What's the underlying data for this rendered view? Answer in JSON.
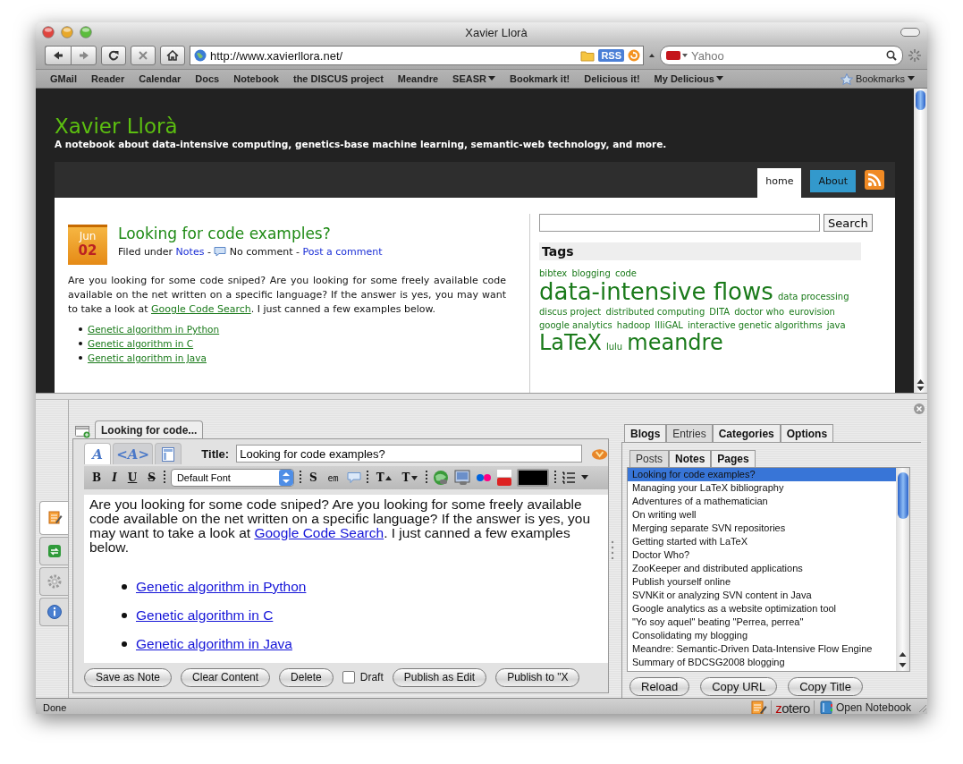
{
  "window": {
    "title": "Xavier Llorà"
  },
  "toolbar": {
    "url": "http://www.xavierllora.net/",
    "feed_badge": "RSS",
    "search": {
      "placeholder": "Yahoo"
    }
  },
  "bookmarks": [
    {
      "label": "GMail",
      "kind": "link"
    },
    {
      "label": "Reader",
      "kind": "link"
    },
    {
      "label": "Calendar",
      "kind": "link"
    },
    {
      "label": "Docs",
      "kind": "link"
    },
    {
      "label": "Notebook",
      "kind": "link"
    },
    {
      "label": "the DISCUS project",
      "kind": "link"
    },
    {
      "label": "Meandre",
      "kind": "link"
    },
    {
      "label": "SEASR",
      "kind": "menu"
    },
    {
      "label": "Bookmark it!",
      "kind": "link"
    },
    {
      "label": "Delicious it!",
      "kind": "link"
    },
    {
      "label": "My Delicious",
      "kind": "menu"
    }
  ],
  "bookmarks_menu": {
    "label": "Bookmarks"
  },
  "site": {
    "title": "Xavier Llorà",
    "tagline": "A notebook about data-intensive computing, genetics-base machine learning, semantic-web technology, and more.",
    "nav": [
      {
        "label": "home",
        "selected": true
      },
      {
        "label": "About",
        "selected": false
      }
    ],
    "post": {
      "month": "Jun",
      "day": "02",
      "title": "Looking for code examples?",
      "meta": [
        {
          "kind": "text",
          "text": "Filed under "
        },
        {
          "kind": "link",
          "text": "Notes"
        },
        {
          "kind": "text",
          "text": " - "
        },
        {
          "kind": "icon"
        },
        {
          "kind": "text",
          "text": " No comment - "
        },
        {
          "kind": "link",
          "text": "Post a comment"
        }
      ],
      "body": {
        "before": "Are you looking for some code sniped? Are you looking for some freely available code available on the net written on a specific language? If the answer is yes, you may want to take a look at ",
        "link": "Google Code Search",
        "after": ". I just canned a few examples below."
      },
      "links": [
        "Genetic algorithm in Python",
        "Genetic algorithm in C",
        "Genetic algorithm in Java"
      ]
    },
    "search_button": "Search",
    "tags_heading": "Tags",
    "tags": [
      {
        "label": "bibtex",
        "kind": "small"
      },
      {
        "label": "blogging",
        "kind": "small"
      },
      {
        "label": "code",
        "kind": "small"
      },
      {
        "label": "data-intensive flows",
        "kind": "huge"
      },
      {
        "label": "data processing",
        "kind": "small"
      },
      {
        "label": "discus project",
        "kind": "small"
      },
      {
        "label": "distributed computing",
        "kind": "small"
      },
      {
        "label": "DITA",
        "kind": "small"
      },
      {
        "label": "doctor who",
        "kind": "small"
      },
      {
        "label": "eurovision",
        "kind": "small"
      },
      {
        "label": "google analytics",
        "kind": "small"
      },
      {
        "label": "hadoop",
        "kind": "small"
      },
      {
        "label": "IlliGAL",
        "kind": "small"
      },
      {
        "label": "interactive genetic algorithms",
        "kind": "small"
      },
      {
        "label": "java",
        "kind": "small"
      },
      {
        "label": "LaTeX",
        "kind": "large"
      },
      {
        "label": "lulu",
        "kind": "small"
      },
      {
        "label": "meandre",
        "kind": "large"
      }
    ]
  },
  "side_tabs": [
    {
      "kind": "edit",
      "selected": true
    },
    {
      "kind": "sync",
      "selected": false
    },
    {
      "kind": "settings",
      "selected": false
    },
    {
      "kind": "info",
      "selected": false
    }
  ],
  "editor": {
    "doc_tab": "Looking for code...",
    "mode_tabs": [
      {
        "label": "A",
        "kind": "rich",
        "selected": true
      },
      {
        "label": "<A>",
        "kind": "html",
        "selected": false
      },
      {
        "kind": "preview",
        "selected": false
      }
    ],
    "title_label": "Title:",
    "title_value": "Looking for code examples?",
    "format_buttons": [
      {
        "label": "B",
        "kind": "bold"
      },
      {
        "label": "I",
        "kind": "italic"
      },
      {
        "label": "U",
        "kind": "underline"
      },
      {
        "label": "S",
        "kind": "strike"
      }
    ],
    "font": "Default Font",
    "tag_buttons": [
      {
        "label": "S",
        "kind": "strong"
      },
      {
        "label": "em",
        "kind": "em"
      }
    ],
    "size_buttons": [
      {
        "label": "T",
        "kind": "grow"
      },
      {
        "label": "T",
        "kind": "shrink"
      }
    ],
    "body": {
      "before": "Are you looking for some code sniped? Are you looking for some freely available code available on the net written on a specific language? If the answer is yes, you may want to take a look at ",
      "link": "Google Code Search",
      "after": ". I just canned a few examples below."
    },
    "links": [
      "Genetic algorithm in Python",
      "Genetic algorithm in C",
      "Genetic algorithm in Java"
    ],
    "actions": [
      {
        "kind": "button",
        "label": "Save as Note"
      },
      {
        "kind": "button",
        "label": "Clear Content"
      },
      {
        "kind": "button",
        "label": "Delete"
      },
      {
        "kind": "checkbox",
        "label": "Draft",
        "checked": false
      },
      {
        "kind": "button",
        "label": "Publish as Edit"
      },
      {
        "kind": "button",
        "label": "Publish to \"X"
      }
    ]
  },
  "manager": {
    "tabs": [
      {
        "label": "Blogs",
        "selected": false
      },
      {
        "label": "Entries",
        "selected": true
      },
      {
        "label": "Categories",
        "selected": false
      },
      {
        "label": "Options",
        "selected": false
      }
    ],
    "subtabs": [
      {
        "label": "Posts",
        "selected": true
      },
      {
        "label": "Notes",
        "selected": false
      },
      {
        "label": "Pages",
        "selected": false
      }
    ],
    "entries": [
      {
        "title": "Looking for code examples?",
        "selected": true
      },
      {
        "title": "Managing your LaTeX bibliography",
        "selected": false
      },
      {
        "title": "Adventures of a mathematician",
        "selected": false
      },
      {
        "title": "On writing well",
        "selected": false
      },
      {
        "title": "Merging separate SVN repositories",
        "selected": false
      },
      {
        "title": "Getting started with LaTeX",
        "selected": false
      },
      {
        "title": "Doctor Who?",
        "selected": false
      },
      {
        "title": "ZooKeeper and distributed applications",
        "selected": false
      },
      {
        "title": "Publish yourself online",
        "selected": false
      },
      {
        "title": "SVNKit or analyzing SVN content in Java",
        "selected": false
      },
      {
        "title": "Google analytics as a website optimization tool",
        "selected": false
      },
      {
        "title": "\"Yo soy aquel\" beating \"Perrea, perrea\"",
        "selected": false
      },
      {
        "title": "Consolidating my blogging",
        "selected": false
      },
      {
        "title": "Meandre: Semantic-Driven Data-Intensive Flow Engine",
        "selected": false
      },
      {
        "title": "Summary of BDCSG2008 blogging",
        "selected": false
      }
    ],
    "buttons": [
      "Reload",
      "Copy URL",
      "Copy Title"
    ]
  },
  "status_bar": {
    "text": "Done",
    "zotero": "zotero",
    "notebook": "Open Notebook"
  }
}
